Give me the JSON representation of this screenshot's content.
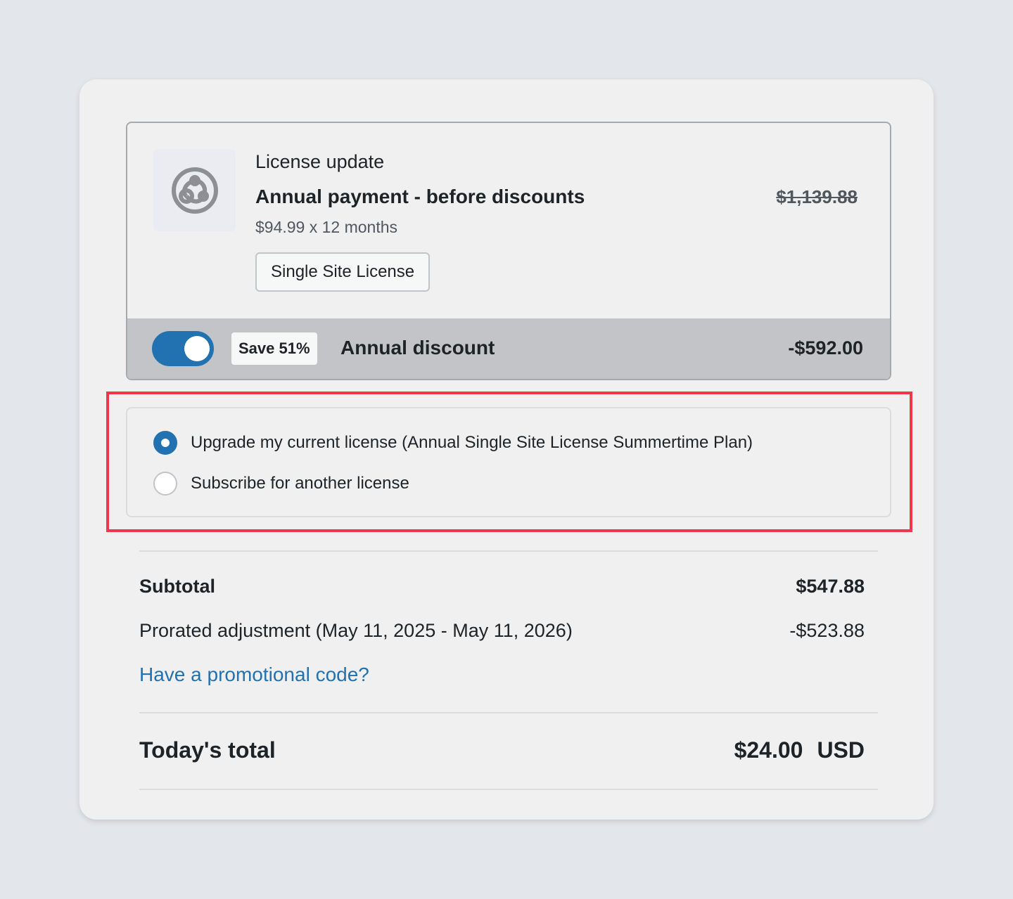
{
  "product": {
    "eyebrow": "License update",
    "title": "Annual payment - before discounts",
    "subtitle": "$94.99 x 12 months",
    "plan_button": "Single Site License",
    "original_price": "$1,139.88",
    "logo_icon": "plugin-logo-icon"
  },
  "discount": {
    "toggle_on": true,
    "badge": "Save 51%",
    "label": "Annual discount",
    "amount": "-$592.00"
  },
  "license_options": [
    {
      "label": "Upgrade my current license (Annual Single Site License Summertime Plan)",
      "selected": true
    },
    {
      "label": "Subscribe for another license",
      "selected": false
    }
  ],
  "summary": {
    "subtotal_label": "Subtotal",
    "subtotal_value": "$547.88",
    "prorated_label": "Prorated adjustment (May 11, 2025 - May 11, 2026)",
    "prorated_value": "-$523.88",
    "promo_link": "Have a promotional code?",
    "total_label": "Today's total",
    "total_value": "$24.00",
    "currency": "USD"
  },
  "colors": {
    "accent": "#2271b1",
    "highlight": "#f0364a",
    "discount_bar": "#c3c4c7"
  }
}
